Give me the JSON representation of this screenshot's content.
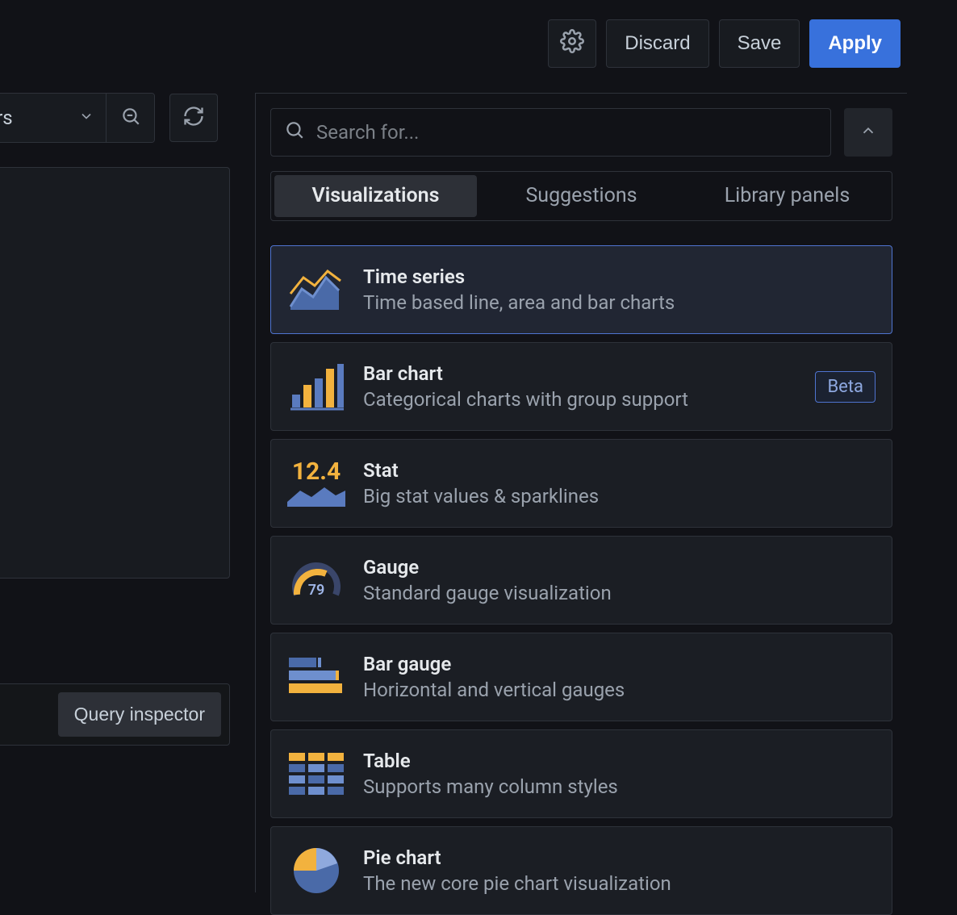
{
  "topbar": {
    "discard": "Discard",
    "save": "Save",
    "apply": "Apply"
  },
  "timerange": {
    "label": "hours"
  },
  "query_inspector": "Query inspector",
  "search": {
    "placeholder": "Search for..."
  },
  "tabs": {
    "visualizations": "Visualizations",
    "suggestions": "Suggestions",
    "library": "Library panels"
  },
  "stat_sample": "12.4",
  "gauge_sample": "79",
  "viz": [
    {
      "title": "Time series",
      "desc": "Time based line, area and bar charts",
      "badge": null
    },
    {
      "title": "Bar chart",
      "desc": "Categorical charts with group support",
      "badge": "Beta"
    },
    {
      "title": "Stat",
      "desc": "Big stat values & sparklines",
      "badge": null
    },
    {
      "title": "Gauge",
      "desc": "Standard gauge visualization",
      "badge": null
    },
    {
      "title": "Bar gauge",
      "desc": "Horizontal and vertical gauges",
      "badge": null
    },
    {
      "title": "Table",
      "desc": "Supports many column styles",
      "badge": null
    },
    {
      "title": "Pie chart",
      "desc": "The new core pie chart visualization",
      "badge": null
    }
  ]
}
